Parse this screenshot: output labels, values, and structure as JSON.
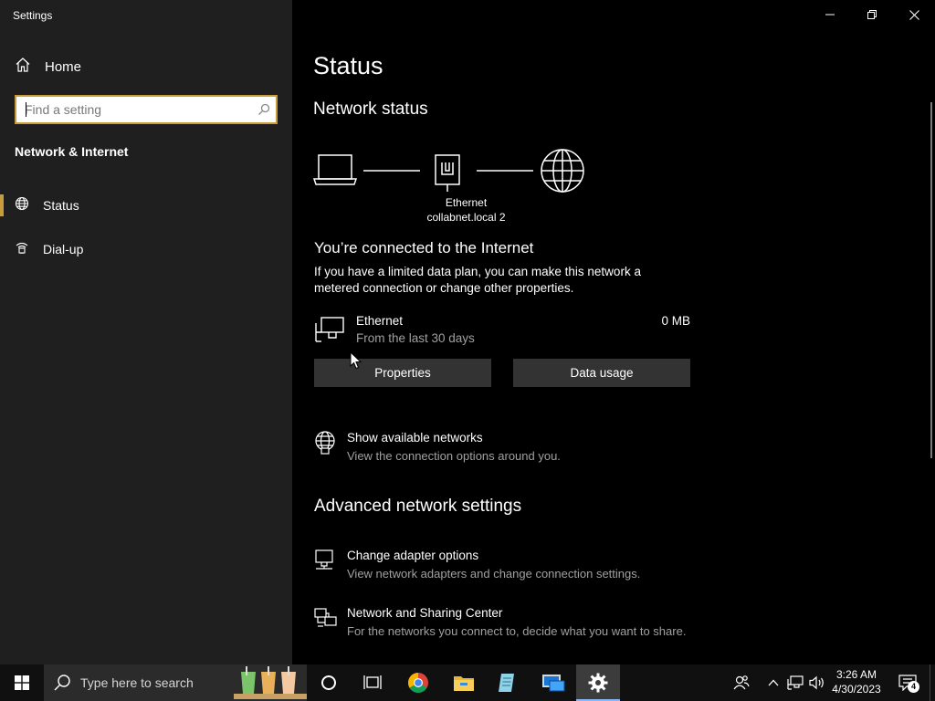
{
  "window": {
    "title": "Settings",
    "controls": {
      "minimize": "minimize",
      "maximize": "restore",
      "close": "close"
    }
  },
  "sidebar": {
    "home_label": "Home",
    "search": {
      "placeholder": "Find a setting",
      "value": ""
    },
    "section_heading": "Network & Internet",
    "items": [
      {
        "label": "Status",
        "icon": "globe-icon",
        "selected": true
      },
      {
        "label": "Dial-up",
        "icon": "dialup-icon",
        "selected": false
      }
    ]
  },
  "main": {
    "title": "Status",
    "network_status_heading": "Network status",
    "diagram": {
      "device_name": "Ethernet",
      "network_name": "collabnet.local 2"
    },
    "connected_title": "You’re connected to the Internet",
    "connected_desc": "If you have a limited data plan, you can make this network a metered connection or change other properties.",
    "adapter": {
      "name": "Ethernet",
      "period": "From the last 30 days",
      "usage": "0 MB"
    },
    "buttons": {
      "properties": "Properties",
      "data_usage": "Data usage"
    },
    "show_networks": {
      "title": "Show available networks",
      "desc": "View the connection options around you."
    },
    "advanced_heading": "Advanced network settings",
    "advanced_items": [
      {
        "title": "Change adapter options",
        "desc": "View network adapters and change connection settings."
      },
      {
        "title": "Network and Sharing Center",
        "desc": "For the networks you connect to, decide what you want to share."
      }
    ]
  },
  "taskbar": {
    "search_placeholder": "Type here to search",
    "pinned": [
      "windows-start-icon",
      "cortana-icon",
      "task-view-icon",
      "chrome-icon",
      "file-explorer-icon",
      "notepad-icon",
      "remote-desktop-icon",
      "settings-gear-icon"
    ],
    "clock": {
      "time": "3:26 AM",
      "date": "4/30/2023"
    },
    "notification_count": "4"
  },
  "colors": {
    "accent": "#c89b3c",
    "sidebar_bg": "#1f1f1f",
    "content_bg": "#000000",
    "secondary_text": "#a0a0a0",
    "button_bg": "#333333",
    "taskbar_bg": "#101010"
  }
}
